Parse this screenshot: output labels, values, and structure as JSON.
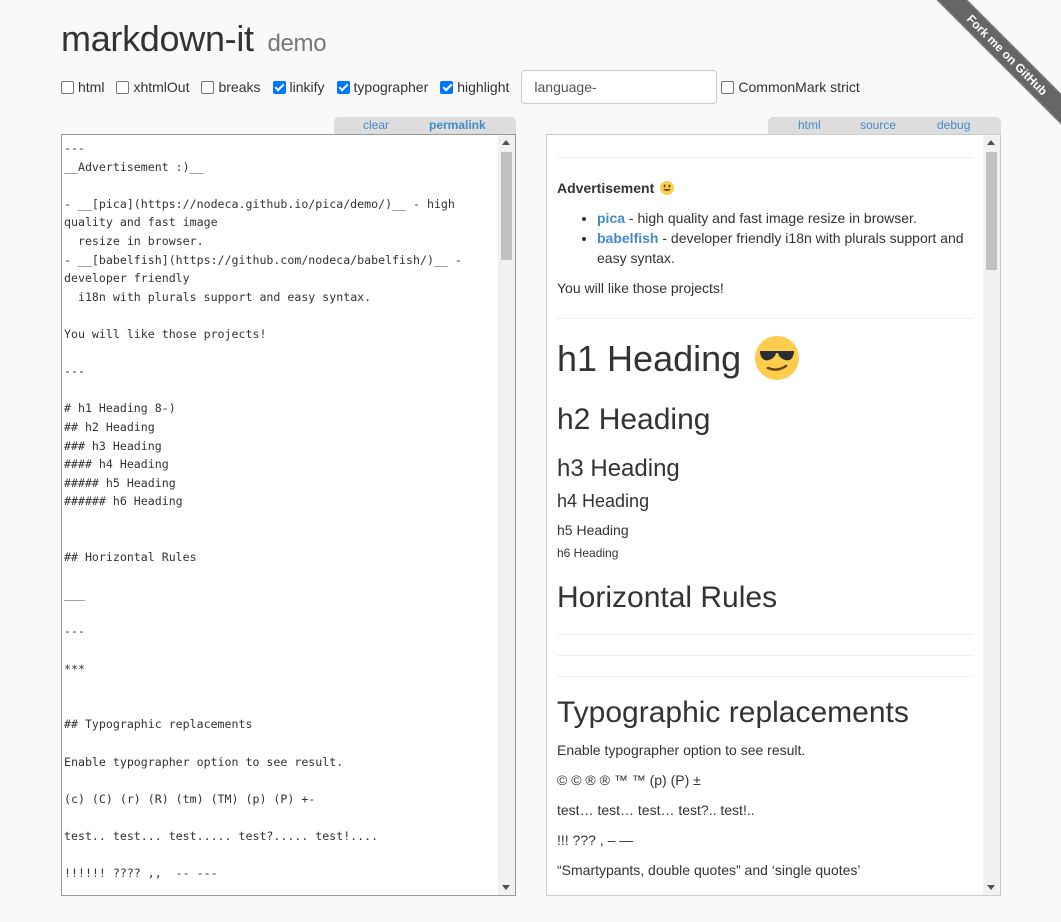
{
  "header": {
    "title": "markdown-it",
    "subtitle": "demo"
  },
  "ribbon": {
    "text": "Fork me on GitHub"
  },
  "options": [
    {
      "label": "html",
      "checked": false
    },
    {
      "label": "xhtmlOut",
      "checked": false
    },
    {
      "label": "breaks",
      "checked": false
    },
    {
      "label": "linkify",
      "checked": true
    },
    {
      "label": "typographer",
      "checked": true
    },
    {
      "label": "highlight",
      "checked": true
    }
  ],
  "lang_prefix": {
    "value": "language-"
  },
  "commonmark": {
    "label": "CommonMark strict",
    "checked": false
  },
  "source_tabs": {
    "clear": "clear",
    "permalink": "permalink"
  },
  "result_tabs": {
    "html": "html",
    "source": "source",
    "debug": "debug"
  },
  "source_text": "---\n__Advertisement :)__\n\n- __[pica](https://nodeca.github.io/pica/demo/)__ - high quality and fast image\n  resize in browser.\n- __[babelfish](https://github.com/nodeca/babelfish/)__ - developer friendly\n  i18n with plurals support and easy syntax.\n\nYou will like those projects!\n\n---\n\n# h1 Heading 8-)\n## h2 Heading\n### h3 Heading\n#### h4 Heading\n##### h5 Heading\n###### h6 Heading\n\n\n## Horizontal Rules\n\n___\n\n---\n\n***\n\n\n## Typographic replacements\n\nEnable typographer option to see result.\n\n(c) (C) (r) (R) (tm) (TM) (p) (P) +-\n\ntest.. test... test..... test?..... test!....\n\n!!!!!! ???? ,,  -- ---",
  "result": {
    "ad_title": "Advertisement",
    "items": [
      {
        "link": "pica",
        "text": " - high quality and fast image resize in browser."
      },
      {
        "link": "babelfish",
        "text": " - developer friendly i18n with plurals support and",
        "text2": "easy syntax."
      }
    ],
    "like": "You will like those projects!",
    "h1": "h1 Heading",
    "h2": "h2 Heading",
    "h3": "h3 Heading",
    "h4": "h4 Heading",
    "h5": "h5 Heading",
    "h6": "h6 Heading",
    "hr_heading": "Horizontal Rules",
    "typo_heading": "Typographic replacements",
    "typo_note": "Enable typographer option to see result.",
    "typo_symbols": "© © ® ® ™ ™ (p) (P) ±",
    "typo_dots": "test… test… test… test?.. test!..",
    "typo_marks": "!!! ??? , – —",
    "typo_quotes": "“Smartypants, double quotes” and ‘single quotes’"
  }
}
